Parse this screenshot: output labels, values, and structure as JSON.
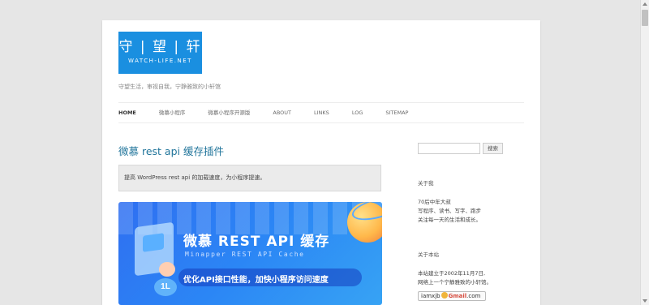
{
  "site": {
    "logo_cn": "守 | 望 | 轩",
    "logo_en": "WATCH-LIFE.NET",
    "tagline": "守望生活，审视自我，宁静雅致的小轩馆"
  },
  "nav": [
    "HOME",
    "微慕小程序",
    "微慕小程序开源版",
    "ABOUT",
    "LINKS",
    "LOG",
    "SITEMAP"
  ],
  "post": {
    "title": "微慕 rest api 缓存插件",
    "excerpt": "提高 WordPress rest api 的加载速度，为小程序提速。"
  },
  "banner": {
    "title": "微慕 REST API 缓存",
    "subtitle": "Minapper REST API Cache",
    "slogan": "优化API接口性能，加快小程序访问速度",
    "badge": "1L"
  },
  "sidebar": {
    "search_button": "搜索",
    "about_me_title": "关于我",
    "about_me_lines": [
      "70后中年大叔",
      "写程序、读书、写字、跑步",
      "关注每一天的生活和成长。"
    ],
    "about_site_title": "关于本站",
    "about_site_lines": [
      "本站建立于2002年11月7日,",
      "网络上一个宁静雅致的小轩馆。"
    ],
    "email_user": "iamxjb",
    "email_domain": "Gmail",
    "email_tld": ".com"
  }
}
